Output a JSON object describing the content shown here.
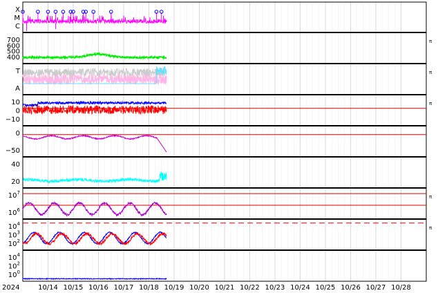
{
  "chart_data": {
    "type": "line",
    "title": "",
    "x_axis": {
      "type": "date",
      "range": [
        "2024-10-13",
        "2024-10-29"
      ],
      "year_label": "2024",
      "tick_labels": [
        "10/14",
        "10/15",
        "10/16",
        "10/17",
        "10/18",
        "10/19",
        "10/20",
        "10/21",
        "10/22",
        "10/23",
        "10/24",
        "10/25",
        "10/26",
        "10/27",
        "10/28"
      ],
      "grid": true,
      "data_end": "2024-10-18.7"
    },
    "panels": [
      {
        "id": "flare-class",
        "y_tick_labels": [
          "X",
          "M",
          "C"
        ],
        "series": [
          {
            "color": "#ff00ff",
            "level_band": "C to M",
            "markers": "circles at M/X events"
          }
        ],
        "events": [
          "2024-10-13.0",
          "2024-10-13.6",
          "2024-10-14.0",
          "2024-10-14.3",
          "2024-10-14.6",
          "2024-10-14.9",
          "2024-10-15.0",
          "2024-10-15.4",
          "2024-10-15.5",
          "2024-10-15.8",
          "2024-10-16.5",
          "2024-10-18.3",
          "2024-10-18.5"
        ]
      },
      {
        "id": "velocity",
        "y_tick_labels": [
          "700",
          "600",
          "500",
          "400"
        ],
        "ylim": [
          350,
          750
        ],
        "series": [
          {
            "color": "#00ee00",
            "typical": 420,
            "peak": 470
          }
        ],
        "side_label": "π"
      },
      {
        "id": "t-a",
        "y_tick_labels": [
          "T",
          "A"
        ],
        "series": [
          {
            "color": "#ffb6e6"
          },
          {
            "color": "#cccccc"
          },
          {
            "color": "#66ddff"
          }
        ],
        "side_label": "π"
      },
      {
        "id": "bz",
        "y_tick_labels": [
          "10",
          "0",
          "−10"
        ],
        "ylim": [
          -20,
          15
        ],
        "reference_line": 0,
        "series": [
          {
            "color": "#0000ff",
            "typical": 7
          },
          {
            "color": "#ff0000",
            "typical": -2
          }
        ],
        "side_label": "π"
      },
      {
        "id": "dst",
        "y_tick_labels": [
          "0",
          "−50"
        ],
        "ylim": [
          -75,
          25
        ],
        "reference_line": 0,
        "series": [
          {
            "color": "#cc00cc",
            "typical": -10,
            "minimum": -65
          }
        ]
      },
      {
        "id": "density",
        "y_tick_labels": [
          "40",
          "20"
        ],
        "ylim": [
          0,
          55
        ],
        "series": [
          {
            "color": "#00ffff",
            "typical": 10,
            "peak": 30
          }
        ]
      },
      {
        "id": "electron-flux",
        "y_tick_labels": [
          "10^7",
          "10^6"
        ],
        "scale": "log",
        "ylim": [
          100000,
          20000000
        ],
        "reference_lines": [
          10000000,
          1000000
        ],
        "series": [
          {
            "color": "#aa00cc",
            "typical": 500000
          }
        ],
        "side_label": "π"
      },
      {
        "id": "proton-flux",
        "y_tick_labels": [
          "10^4",
          "10^3",
          "10^2"
        ],
        "scale": "log",
        "ylim": [
          1,
          20000
        ],
        "reference_line": 10000,
        "reference_style": "dashed",
        "series": [
          {
            "color": "#0000ff"
          },
          {
            "color": "#ff0000"
          }
        ],
        "side_label": "π"
      },
      {
        "id": "high-energy",
        "y_tick_labels": [
          "10^4",
          "10^2",
          "10^0"
        ],
        "scale": "log",
        "ylim": [
          1,
          100000
        ],
        "series": [
          {
            "color": "#0000ff",
            "typical": 1
          }
        ]
      }
    ]
  }
}
